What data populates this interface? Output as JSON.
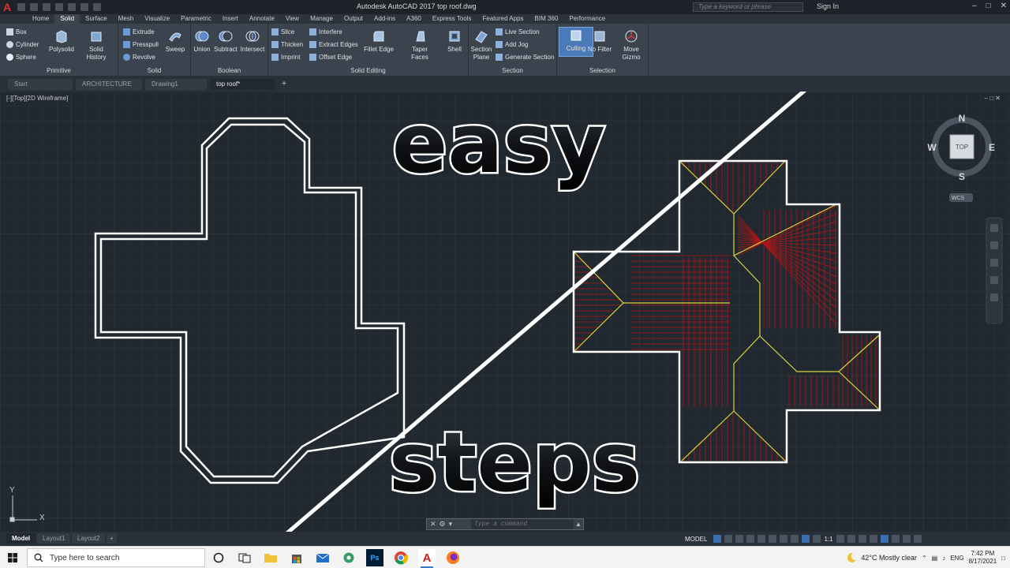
{
  "titlebar": {
    "app_title": "Autodesk AutoCAD 2017   top roof.dwg",
    "search_placeholder": "Type a keyword or phrase",
    "sign_in": "Sign In"
  },
  "ribbon_tabs": [
    "Home",
    "Solid",
    "Surface",
    "Mesh",
    "Visualize",
    "Parametric",
    "Insert",
    "Annotate",
    "View",
    "Manage",
    "Output",
    "Add-ins",
    "A360",
    "Express Tools",
    "Featured Apps",
    "BIM 360",
    "Performance"
  ],
  "ribbon": {
    "primitive": {
      "title": "Primitive",
      "box": "Box",
      "cylinder": "Cylinder",
      "sphere": "Sphere",
      "polysolid": "Polysolid"
    },
    "solid": {
      "title": "Solid",
      "history": "Solid History",
      "extrude": "Extrude",
      "presspull": "Presspull",
      "revolve": "Revolve",
      "sweep": "Sweep"
    },
    "boolean": {
      "title": "Boolean",
      "union": "Union",
      "subtract": "Subtract",
      "intersect": "Intersect"
    },
    "solid_editing": {
      "title": "Solid Editing",
      "slice": "Slice",
      "thicken": "Thicken",
      "imprint": "Imprint",
      "interfere": "Interfere",
      "extract_edges": "Extract Edges",
      "offset_edge": "Offset Edge",
      "fillet_edge": "Fillet Edge",
      "taper_faces": "Taper Faces",
      "shell": "Shell"
    },
    "section": {
      "title": "Section",
      "section_plane": "Section Plane",
      "live_section": "Live Section",
      "add_jog": "Add Jog",
      "generate_section": "Generate Section"
    },
    "selection": {
      "title": "Selection",
      "culling": "Culling",
      "no_filter": "No Filter",
      "move_gizmo": "Move Gizmo"
    }
  },
  "doc_tabs": [
    "Start",
    "ARCHITECTURE",
    "Drawing1",
    "top roof*"
  ],
  "viewport_label": "[-][Top][2D Wireframe]",
  "viewcube": {
    "top": "TOP",
    "north": "N",
    "south": "S",
    "west": "W",
    "east": "E",
    "wcs": "WCS"
  },
  "ucs": {
    "x": "X",
    "y": "Y"
  },
  "overlay_text": {
    "word1": "easy",
    "word2": "steps"
  },
  "command_line": {
    "placeholder": "Type a command"
  },
  "layout_tabs": [
    "Model",
    "Layout1",
    "Layout2"
  ],
  "status": {
    "model": "MODEL",
    "scale": "1:1"
  },
  "taskbar": {
    "search_placeholder": "Type here to search",
    "weather": "42°C  Mostly clear",
    "lang": "ENG",
    "time": "7:42 PM",
    "date": "8/17/2021"
  },
  "colors": {
    "roof_lines": "#b01616",
    "ridge_lines": "#d8d43a",
    "outline": "#ffffff",
    "background": "#212830"
  }
}
